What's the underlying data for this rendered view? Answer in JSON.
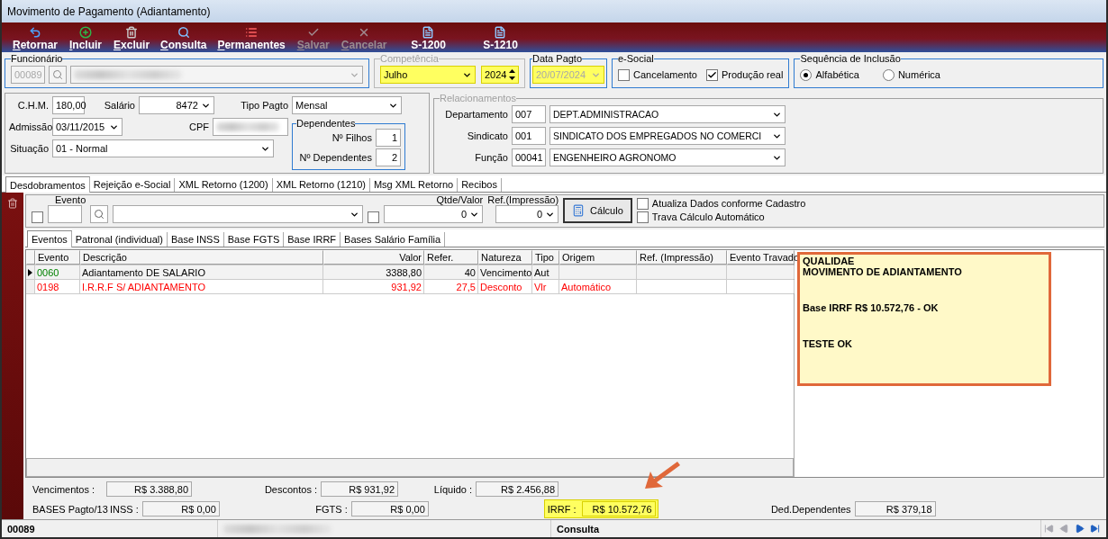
{
  "window": {
    "title": "Movimento de Pagamento (Adiantamento)"
  },
  "toolbar": [
    {
      "label": "Retornar",
      "kind": "return",
      "disabled": false
    },
    {
      "label": "Incluir",
      "kind": "add",
      "disabled": false
    },
    {
      "label": "Excluir",
      "kind": "delete",
      "disabled": false
    },
    {
      "label": "Consulta",
      "kind": "search",
      "disabled": false
    },
    {
      "label": "Permanentes",
      "kind": "list",
      "disabled": false
    },
    {
      "label": "Salvar",
      "kind": "save",
      "disabled": true
    },
    {
      "label": "Cancelar",
      "kind": "cancel",
      "disabled": true
    },
    {
      "label": "S-1200",
      "kind": "doc",
      "disabled": false
    },
    {
      "label": "S-1210",
      "kind": "doc",
      "disabled": false
    }
  ],
  "funcionario": {
    "label": "Funcionário",
    "code": "00089"
  },
  "competencia": {
    "label": "Competência",
    "month": "Julho",
    "year": "2024"
  },
  "data_pagto": {
    "label": "Data Pagto",
    "value": "20/07/2024",
    "disabled": true
  },
  "esocial": {
    "label": "e-Social",
    "options": [
      {
        "label": "Cancelamento",
        "checked": false
      },
      {
        "label": "Produção real",
        "checked": true
      }
    ]
  },
  "sequencia": {
    "label": "Sequência de Inclusão",
    "options": [
      {
        "label": "Alfabética",
        "selected": true
      },
      {
        "label": "Numérica",
        "selected": false
      }
    ]
  },
  "dados": {
    "chm_label": "C.H.M.",
    "chm": "180,00",
    "salario_label": "Salário",
    "salario": "8472",
    "tipo_label": "Tipo Pagto",
    "tipo": "Mensal",
    "admissao_label": "Admissão",
    "admissao": "03/11/2015",
    "cpf_label": "CPF",
    "situacao_label": "Situação",
    "situacao": "01 - Normal",
    "dependentes": {
      "label": "Dependentes",
      "filhos_label": "Nº Filhos",
      "filhos": "1",
      "dep_label": "Nº Dependentes",
      "dep": "2"
    }
  },
  "relacionamentos": {
    "label": "Relacionamentos",
    "rows": [
      {
        "label": "Departamento",
        "code": "007",
        "value": "DEPT.ADMINISTRACAO"
      },
      {
        "label": "Sindicato",
        "code": "001",
        "value": "SINDICATO DOS EMPREGADOS NO COMERCI"
      },
      {
        "label": "Função",
        "code": "00041",
        "value": "ENGENHEIRO AGRONOMO"
      }
    ]
  },
  "tabs": [
    {
      "label": "Desdobramentos",
      "selected": true
    },
    {
      "label": "Rejeição e-Social",
      "selected": false
    },
    {
      "label": "XML Retorno (1200)",
      "selected": false
    },
    {
      "label": "XML Retorno (1210)",
      "selected": false
    },
    {
      "label": "Msg XML Retorno",
      "selected": false
    },
    {
      "label": "Recibos",
      "selected": false
    }
  ],
  "filtro": {
    "evento_checked": false,
    "qtde_checked": false,
    "evento_label": "Evento",
    "qtde_label": "Qtde/Valor",
    "qtde": "0",
    "ref_label": "Ref.(Impressão)",
    "ref": "0",
    "calc": "Cálculo",
    "options": [
      {
        "label": "Atualiza Dados conforme Cadastro",
        "checked": false
      },
      {
        "label": "Trava Cálculo Automático",
        "checked": false
      }
    ]
  },
  "subtabs": [
    {
      "label": "Eventos",
      "selected": true
    },
    {
      "label": "Patronal (individual)",
      "selected": false
    },
    {
      "label": "Base INSS",
      "selected": false
    },
    {
      "label": "Base FGTS",
      "selected": false
    },
    {
      "label": "Base IRRF",
      "selected": false
    },
    {
      "label": "Bases Salário Família",
      "selected": false
    }
  ],
  "grid": {
    "columns": [
      "Evento",
      "Descrição",
      "Valor",
      "Refer.",
      "Natureza",
      "Tipo",
      "Origem",
      "Ref. (Impressão)",
      "Evento Travado"
    ],
    "rows": [
      {
        "kind": "earning",
        "selected": true,
        "cells": [
          "0060",
          "Adiantamento DE SALARIO",
          "3388,80",
          "40",
          "Vencimento",
          "Aut",
          "",
          "",
          ""
        ]
      },
      {
        "kind": "deduction",
        "selected": false,
        "cells": [
          "0198",
          "I.R.R.F S/ ADIANTAMENTO",
          "931,92",
          "27,5",
          "Desconto",
          "Vlr",
          "Automático",
          "",
          ""
        ]
      }
    ]
  },
  "note": {
    "paragraphs": [
      [
        "QUALIDAE",
        "MOVIMENTO DE ADIANTAMENTO"
      ],
      [
        "Base IRRF R$ 10.572,76 - OK"
      ],
      [
        "TESTE OK"
      ]
    ]
  },
  "totais": {
    "vencimentos_label": "Vencimentos :",
    "vencimentos": "R$ 3.388,80",
    "descontos_label": "Descontos :",
    "descontos": "R$ 931,92",
    "liquido_label": "Líquido :",
    "liquido": "R$ 2.456,88",
    "bases_label": "BASES Pagto/13",
    "inss_label": "INSS :",
    "inss": "R$ 0,00",
    "fgts_label": "FGTS :",
    "fgts": "R$ 0,00",
    "irrf_label": "IRRF :",
    "irrf": "R$ 10.572,76",
    "ded_label": "Ded.Dependentes",
    "ded": "R$ 379,18"
  },
  "status_bar": {
    "code": "00089",
    "mode": "Consulta"
  },
  "nav": [
    {
      "kind": "first",
      "disabled": true
    },
    {
      "kind": "prev",
      "disabled": true
    },
    {
      "kind": "next",
      "disabled": false
    },
    {
      "kind": "last",
      "disabled": false
    }
  ]
}
